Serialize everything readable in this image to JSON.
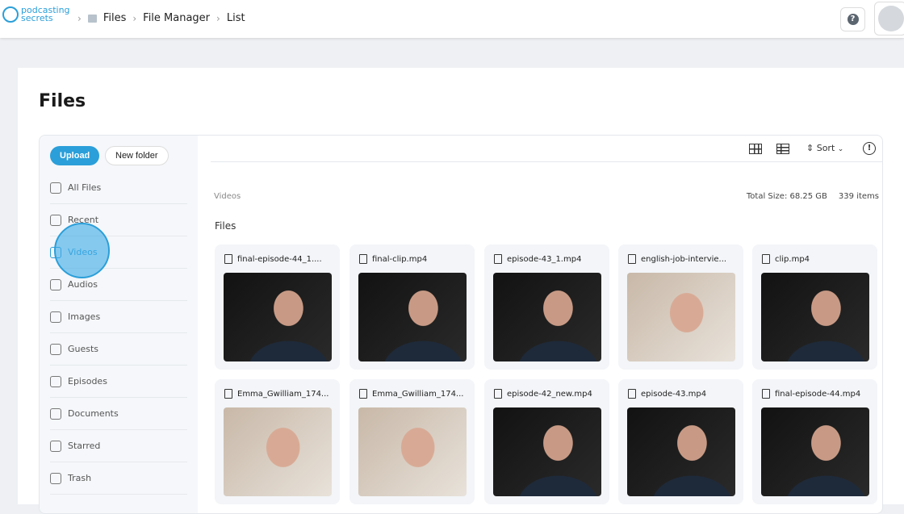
{
  "header": {
    "logo": "podcasting secrets",
    "breadcrumb": [
      "Files",
      "File Manager",
      "List"
    ],
    "help_icon": "?"
  },
  "page_title": "Files",
  "sidebar": {
    "upload": "Upload",
    "new_folder": "New folder",
    "items": [
      {
        "label": "All Files"
      },
      {
        "label": "Recent"
      },
      {
        "label": "Videos",
        "active": true
      },
      {
        "label": "Audios"
      },
      {
        "label": "Images"
      },
      {
        "label": "Guests"
      },
      {
        "label": "Episodes"
      },
      {
        "label": "Documents"
      },
      {
        "label": "Starred"
      },
      {
        "label": "Trash"
      }
    ]
  },
  "toolbar": {
    "sort": "Sort",
    "info": "!"
  },
  "path": "Videos",
  "total_size": "Total Size: 68.25 GB",
  "item_count": "339 items",
  "files_heading": "Files",
  "files": [
    {
      "name": "final-episode-44_1....",
      "thumb": "dark"
    },
    {
      "name": "final-clip.mp4",
      "thumb": "dark"
    },
    {
      "name": "episode-43_1.mp4",
      "thumb": "dark"
    },
    {
      "name": "english-job-intervie...",
      "thumb": "light"
    },
    {
      "name": "clip.mp4",
      "thumb": "dark"
    },
    {
      "name": "Emma_Gwilliam_174...",
      "thumb": "light"
    },
    {
      "name": "Emma_Gwilliam_174...",
      "thumb": "light"
    },
    {
      "name": "episode-42_new.mp4",
      "thumb": "dark"
    },
    {
      "name": "episode-43.mp4",
      "thumb": "dark"
    },
    {
      "name": "final-episode-44.mp4",
      "thumb": "dark"
    }
  ],
  "accent": "#2b9fd9"
}
